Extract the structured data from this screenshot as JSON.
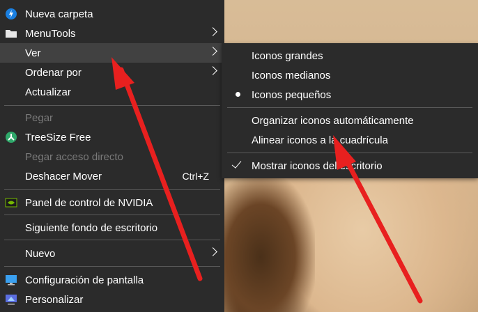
{
  "context_menu": {
    "items": [
      {
        "label": "Nueva carpeta",
        "icon": "new-folder-blue-icon"
      },
      {
        "label": "MenuTools",
        "icon": "folder-icon",
        "submenu": true
      },
      {
        "label": "Ver",
        "submenu": true,
        "highlighted": true
      },
      {
        "label": "Ordenar por",
        "submenu": true
      },
      {
        "label": "Actualizar"
      },
      {
        "label": "Pegar",
        "disabled": true
      },
      {
        "label": "TreeSize Free",
        "icon": "treesize-icon"
      },
      {
        "label": "Pegar acceso directo",
        "disabled": true
      },
      {
        "label": "Deshacer Mover",
        "shortcut": "Ctrl+Z"
      },
      {
        "label": "Panel de control de NVIDIA",
        "icon": "nvidia-icon"
      },
      {
        "label": "Siguiente fondo de escritorio"
      },
      {
        "label": "Nuevo",
        "submenu": true
      },
      {
        "label": "Configuración de pantalla",
        "icon": "display-settings-icon"
      },
      {
        "label": "Personalizar",
        "icon": "personalize-icon"
      }
    ]
  },
  "ver_submenu": {
    "items": [
      {
        "label": "Iconos grandes"
      },
      {
        "label": "Iconos medianos"
      },
      {
        "label": "Iconos pequeños",
        "selected": true
      },
      {
        "label": "Organizar iconos automáticamente"
      },
      {
        "label": "Alinear iconos a la cuadrícula"
      },
      {
        "label": "Mostrar iconos del escritorio",
        "checked": true
      }
    ]
  },
  "colors": {
    "menu_bg": "#2b2b2b",
    "highlight": "#414141",
    "arrow": "#e8201f",
    "disabled_text": "#7a7a7a"
  }
}
